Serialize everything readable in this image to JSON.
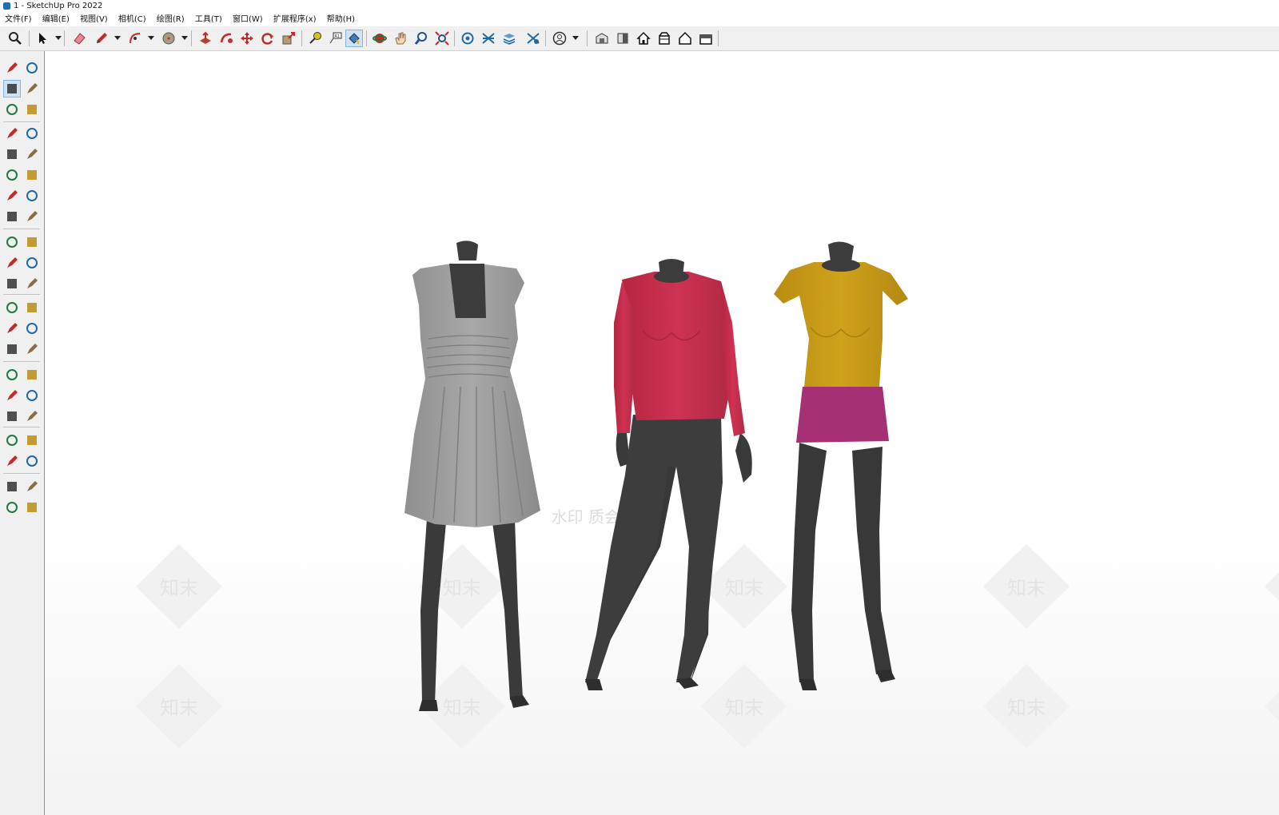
{
  "window": {
    "title": "1 - SketchUp Pro 2022"
  },
  "menu": [
    {
      "label": "文件(F)"
    },
    {
      "label": "编辑(E)"
    },
    {
      "label": "视图(V)"
    },
    {
      "label": "相机(C)"
    },
    {
      "label": "绘图(R)"
    },
    {
      "label": "工具(T)"
    },
    {
      "label": "窗口(W)"
    },
    {
      "label": "扩展程序(x)"
    },
    {
      "label": "帮助(H)"
    }
  ],
  "toolbar": {
    "tools": [
      "zoom-icon",
      "select-icon",
      "eraser-icon",
      "pencil-icon",
      "arc-icon",
      "circle-icon",
      "push-pull-icon",
      "follow-me-icon",
      "move-icon",
      "rotate-icon",
      "scale-icon",
      "tape-measure-icon",
      "text-icon",
      "paint-bucket-icon",
      "orbit-icon",
      "pan-icon",
      "zoom-window-icon",
      "zoom-extents-icon",
      "add-location-icon",
      "sandbox-icon",
      "layers-icon",
      "sandbox-tools-icon",
      "user-account-icon",
      "warehouse-icon",
      "extension-warehouse-icon",
      "home-icon",
      "component-icon",
      "house-icon",
      "box-icon"
    ],
    "active_tool": "paint-bucket-icon"
  },
  "left_toolbar": {
    "tools": [
      "select-icon",
      "orbit-icon",
      "paint-bucket-icon",
      "eraser-icon",
      "component-icon",
      "tag-icon",
      "pencil-icon",
      "freehand-icon",
      "rectangle-icon",
      "rotated-rectangle-icon",
      "circle-icon",
      "polygon-icon",
      "arc-icon",
      "two-point-arc-icon",
      "three-point-arc-icon",
      "pie-icon",
      "move-icon",
      "push-pull-icon",
      "rotate-icon",
      "follow-me-icon",
      "scale-icon",
      "offset-icon",
      "tape-measure-icon",
      "dimension-icon",
      "protractor-icon",
      "text-icon",
      "axes-icon",
      "3d-text-icon",
      "orbit-icon",
      "pan-icon",
      "zoom-icon",
      "zoom-window-icon",
      "zoom-extents-icon",
      "previous-view-icon",
      "position-camera-icon",
      "look-around-icon",
      "walk-icon",
      "section-plane-icon",
      "add-location-icon",
      "sandbox-icon",
      "layers-icon",
      "sandbox-tools-icon"
    ]
  },
  "scene": {
    "watermark_text": "知末",
    "watermark_caption": "水印 质会 创部",
    "colors": {
      "dress": "#9a9a9a",
      "mannequin": "#3c3c3c",
      "red_top": "#c8304f",
      "yellow_top": "#c79a17",
      "magenta_skirt": "#a53074",
      "pants": "#3a3a3a",
      "floor": "#f7f7f7"
    }
  }
}
